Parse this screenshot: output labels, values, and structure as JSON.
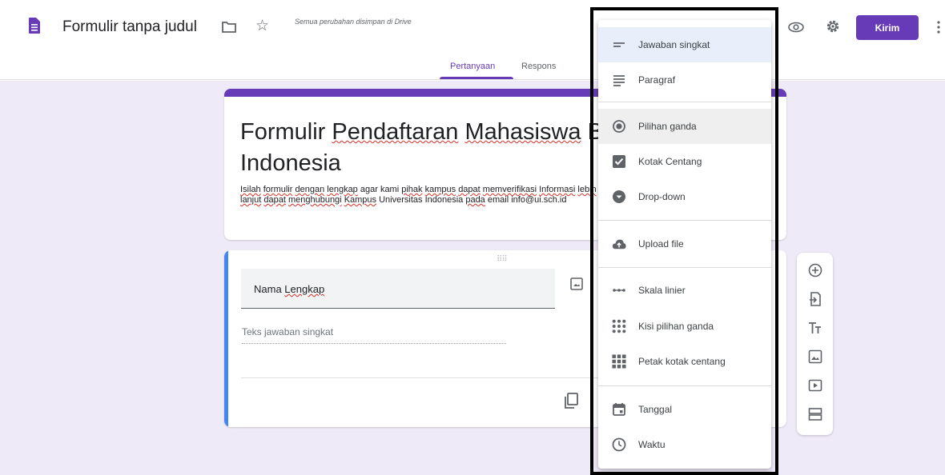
{
  "header": {
    "form_title": "Formulir tanpa judul",
    "save_status": "Semua perubahan disimpan di Drive",
    "send_label": "Kirim",
    "tabs": [
      {
        "label": "Pertanyaan",
        "active": true
      },
      {
        "label": "Respons",
        "active": false
      }
    ]
  },
  "title_card": {
    "title_part1": "Formulir ",
    "title_part2": "Pendaftaran",
    "title_part3": " ",
    "title_part4": "Mahasiswa",
    "title_part5": " B",
    "title_line2": "Indonesia",
    "description": [
      {
        "t": "Isilah",
        "sq": true
      },
      {
        "t": " ",
        "sq": false
      },
      {
        "t": "formulir",
        "sq": true
      },
      {
        "t": " ",
        "sq": false
      },
      {
        "t": "dengan",
        "sq": true
      },
      {
        "t": " ",
        "sq": false
      },
      {
        "t": "lengkap",
        "sq": true
      },
      {
        "t": " agar kami ",
        "sq": false
      },
      {
        "t": "pihak",
        "sq": true
      },
      {
        "t": " ",
        "sq": false
      },
      {
        "t": "kampus",
        "sq": true
      },
      {
        "t": " ",
        "sq": false
      },
      {
        "t": "dapat",
        "sq": true
      },
      {
        "t": " ",
        "sq": false
      },
      {
        "t": "memverifikasi",
        "sq": true
      },
      {
        "t": " ",
        "sq": false
      },
      {
        "t": "Informasi",
        "sq": true
      },
      {
        "t": " ",
        "sq": false
      },
      {
        "t": "lebih",
        "sq": true
      },
      {
        "t": " ",
        "sq": false
      },
      {
        "t": "lanjut",
        "sq": true
      },
      {
        "t": " ",
        "sq": false
      },
      {
        "t": "dapat",
        "sq": true
      },
      {
        "t": " ",
        "sq": false
      },
      {
        "t": "menghubungi",
        "sq": true
      },
      {
        "t": " ",
        "sq": false
      },
      {
        "t": "Kampus",
        "sq": true
      },
      {
        "t": " Universitas Indonesia ",
        "sq": false
      },
      {
        "t": "pada",
        "sq": true
      },
      {
        "t": " email info@ui.sch.id",
        "sq": false
      }
    ]
  },
  "question_card": {
    "title_prefix": "Nama ",
    "title_word": "Lengkap",
    "answer_placeholder": "Teks jawaban singkat"
  },
  "menu": {
    "items": [
      {
        "label": "Jawaban singkat",
        "icon": "short-answer-icon"
      },
      {
        "label": "Paragraf",
        "icon": "paragraph-icon"
      },
      {
        "label": "Pilihan ganda",
        "icon": "radio-icon"
      },
      {
        "label": "Kotak Centang",
        "icon": "checkbox-icon"
      },
      {
        "label": "Drop-down",
        "icon": "dropdown-icon"
      },
      {
        "label": "Upload file",
        "icon": "cloud-upload-icon"
      },
      {
        "label": "Skala linier",
        "icon": "linear-scale-icon"
      },
      {
        "label": "Kisi pilihan ganda",
        "icon": "grid-dots-icon"
      },
      {
        "label": "Petak kotak centang",
        "icon": "grid-squares-icon"
      },
      {
        "label": "Tanggal",
        "icon": "calendar-icon"
      },
      {
        "label": "Waktu",
        "icon": "clock-icon"
      }
    ]
  },
  "side_toolbar": {
    "icons": [
      "add-question-icon",
      "import-question-icon",
      "title-text-icon",
      "image-icon",
      "video-icon",
      "section-icon"
    ]
  },
  "colors": {
    "accent": "#673ab7",
    "question_bar": "#4285f4",
    "canvas": "#efeaf7"
  }
}
